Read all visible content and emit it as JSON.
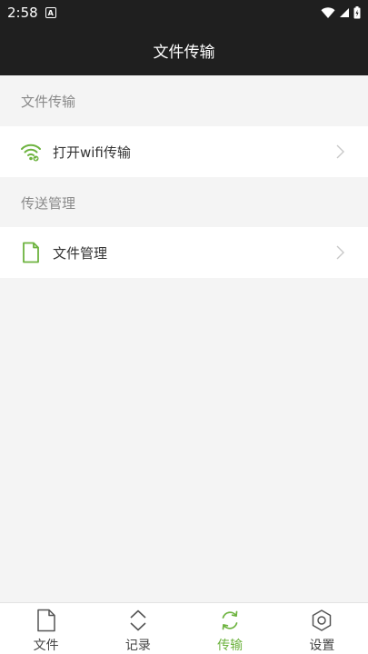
{
  "status_bar": {
    "time": "2:58",
    "notification_glyph": "A"
  },
  "title_bar": {
    "title": "文件传输"
  },
  "sections": [
    {
      "header": "文件传输",
      "item": {
        "label": "打开wifi传输",
        "icon": "wifi-transfer-icon"
      }
    },
    {
      "header": "传送管理",
      "item": {
        "label": "文件管理",
        "icon": "file-icon"
      }
    }
  ],
  "tabs": [
    {
      "label": "文件",
      "icon": "file-icon"
    },
    {
      "label": "记录",
      "icon": "chevron-up-down-icon"
    },
    {
      "label": "传输",
      "icon": "sync-icon",
      "active": true
    },
    {
      "label": "设置",
      "icon": "gear-icon"
    }
  ],
  "colors": {
    "accent": "#6db33f",
    "bar": "#1f1f1f",
    "background": "#f4f4f4"
  }
}
